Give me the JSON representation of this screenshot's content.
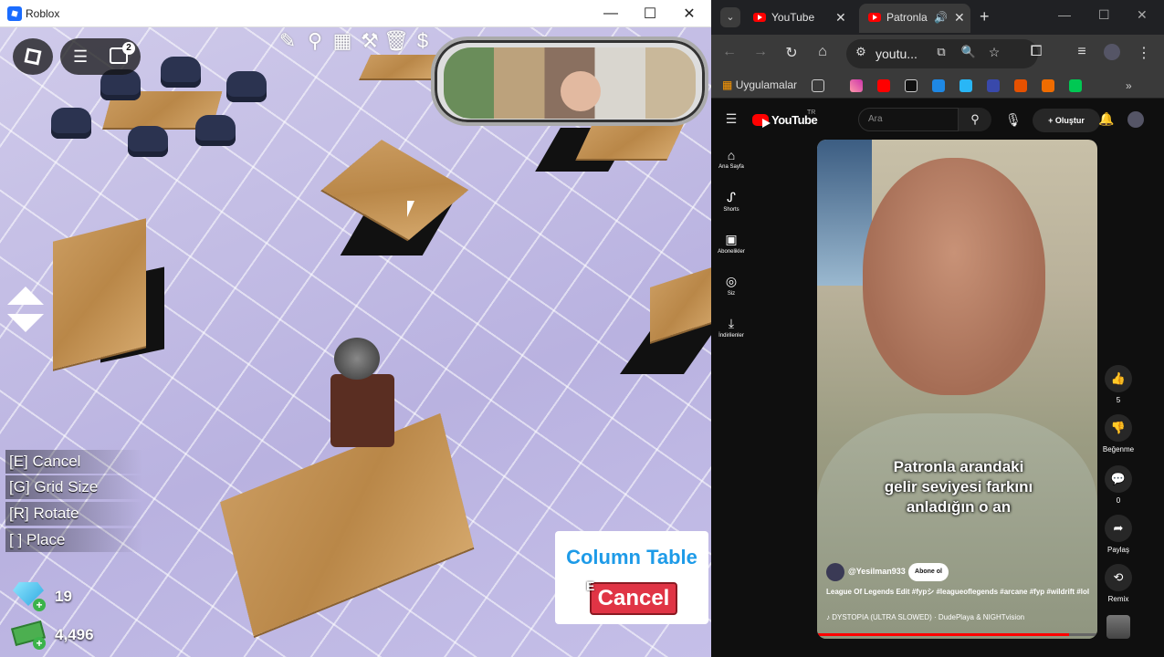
{
  "roblox": {
    "window_title": "Roblox",
    "chat_badge": "2",
    "keybinds": [
      "[E] Cancel",
      "[G] Grid Size",
      "[R] Rotate",
      "[  ] Place"
    ],
    "gems": "19",
    "cash": "4,496",
    "placement_panel": {
      "title": "Column Table",
      "cancel_key": "E",
      "cancel_label": "Cancel"
    }
  },
  "browser": {
    "tabs": [
      {
        "label": "YouTube"
      },
      {
        "label": "Patronla"
      }
    ],
    "url": "youtu...",
    "bookmarks_label": "Uygulamalar"
  },
  "youtube": {
    "logo": "YouTube",
    "region": "TR",
    "search_placeholder": "Ara",
    "create_label": "Oluştur",
    "sidebar": [
      {
        "icon": "home-icon",
        "label": "Ana Sayfa"
      },
      {
        "icon": "shorts-icon",
        "label": "Shorts"
      },
      {
        "icon": "subscriptions-icon",
        "label": "Abonelikler"
      },
      {
        "icon": "you-icon",
        "label": "Siz"
      },
      {
        "icon": "downloads-icon",
        "label": "İndirilenler"
      }
    ],
    "short": {
      "caption_lines": [
        "Patronla arandaki",
        "gelir seviyesi farkını",
        "anladığın o an"
      ],
      "channel": "@Yesilman933",
      "subscribe_label": "Abone ol",
      "description": "League Of Legends Edit #fypシ #leagueoflegends #arcane #fyp #wildrift #lol",
      "music": "DYSTOPIA (ULTRA SLOWED) · DudePlaya & NIGHTvision",
      "progress": 0.9
    },
    "actions": {
      "like_count": "5",
      "dislike_label": "Beğenme",
      "comment_count": "0",
      "share_label": "Paylaş",
      "remix_label": "Remix"
    }
  }
}
